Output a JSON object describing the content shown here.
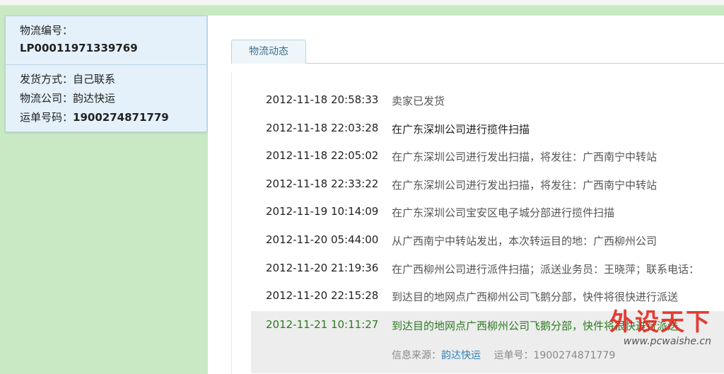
{
  "info": {
    "tracking_label": "物流编号：",
    "tracking_number": "LP00011971339769",
    "shipping_method_label": "发货方式：",
    "shipping_method": "自己联系",
    "company_label": "物流公司：",
    "company": "韵达快运",
    "waybill_label": "运单号码：",
    "waybill": "1900274871779"
  },
  "tab": {
    "label": "物流动态"
  },
  "events": [
    {
      "time": "2012-11-18 20:58:33",
      "desc": "卖家已发货"
    },
    {
      "time": "2012-11-18 22:03:28",
      "desc": "在广东深圳公司进行揽件扫描"
    },
    {
      "time": "2012-11-18 22:05:02",
      "desc": "在广东深圳公司进行发出扫描，将发往：广西南宁中转站"
    },
    {
      "time": "2012-11-18 22:33:22",
      "desc": "在广东深圳公司进行发出扫描，将发往：广西南宁中转站"
    },
    {
      "time": "2012-11-19 10:14:09",
      "desc": "在广东深圳公司宝安区电子城分部进行揽件扫描"
    },
    {
      "time": "2012-11-20 05:44:00",
      "desc": "从广西南宁中转站发出，本次转运目的地：广西柳州公司"
    },
    {
      "time": "2012-11-20 21:19:36",
      "desc": "在广西柳州公司进行派件扫描；派送业务员：王晓萍；联系电话："
    },
    {
      "time": "2012-11-20 22:15:28",
      "desc": "到达目的地网点广西柳州公司飞鹅分部，快件将很快进行派送"
    }
  ],
  "latest": {
    "time": "2012-11-21 10:11:27",
    "desc": "到达目的地网点广西柳州公司飞鹅分部，快件将很快进行派送",
    "source_label": "信息来源：",
    "source_company": "韵达快运",
    "waybill_label": "运单号：",
    "waybill": "1900274871779"
  },
  "watermark": {
    "main": "外设天下",
    "url": "www.pcwaishe.cn"
  },
  "colors": {
    "page_bg": "#c8e9c4",
    "card_bg": "#e4f1fb",
    "latest_text": "#2d7a21",
    "link": "#2e7fb8",
    "watermark": "#e2241b"
  }
}
